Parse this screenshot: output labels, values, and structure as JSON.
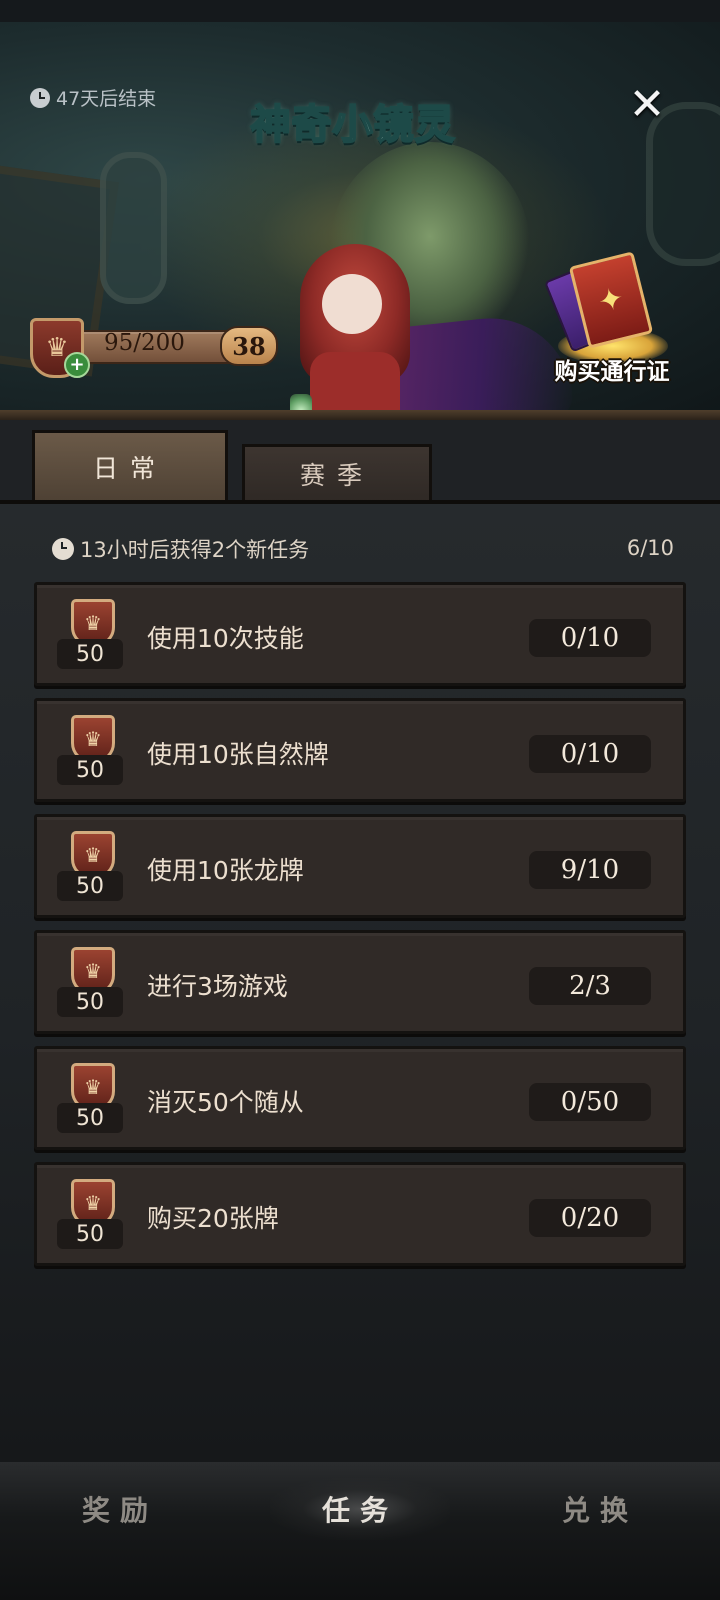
{
  "banner": {
    "timer_text": "47天后结束",
    "logo_text": "神奇小镜灵",
    "close_label": "✕",
    "progress_text": "95/200",
    "level": "38",
    "buy_pass_label": "购买通行证"
  },
  "tabs": [
    {
      "label": "日常",
      "active": true
    },
    {
      "label": "赛季",
      "active": false
    }
  ],
  "tasks_header": {
    "refresh_text": "13小时后获得2个新任务",
    "count": "6/10"
  },
  "tasks": [
    {
      "reward": "50",
      "desc": "使用10次技能",
      "progress": "0/10"
    },
    {
      "reward": "50",
      "desc": "使用10张自然牌",
      "progress": "0/10"
    },
    {
      "reward": "50",
      "desc": "使用10张龙牌",
      "progress": "9/10"
    },
    {
      "reward": "50",
      "desc": "进行3场游戏",
      "progress": "2/3"
    },
    {
      "reward": "50",
      "desc": "消灭50个随从",
      "progress": "0/50"
    },
    {
      "reward": "50",
      "desc": "购买20张牌",
      "progress": "0/20"
    }
  ],
  "bottom_nav": [
    {
      "label": "奖励",
      "active": false
    },
    {
      "label": "任务",
      "active": true
    },
    {
      "label": "兑换",
      "active": false
    }
  ],
  "colors": {
    "background": "#1a1c1e",
    "card": "#302a27",
    "tab_active": "#6b5a48",
    "accent_gold": "#e6b36a"
  }
}
